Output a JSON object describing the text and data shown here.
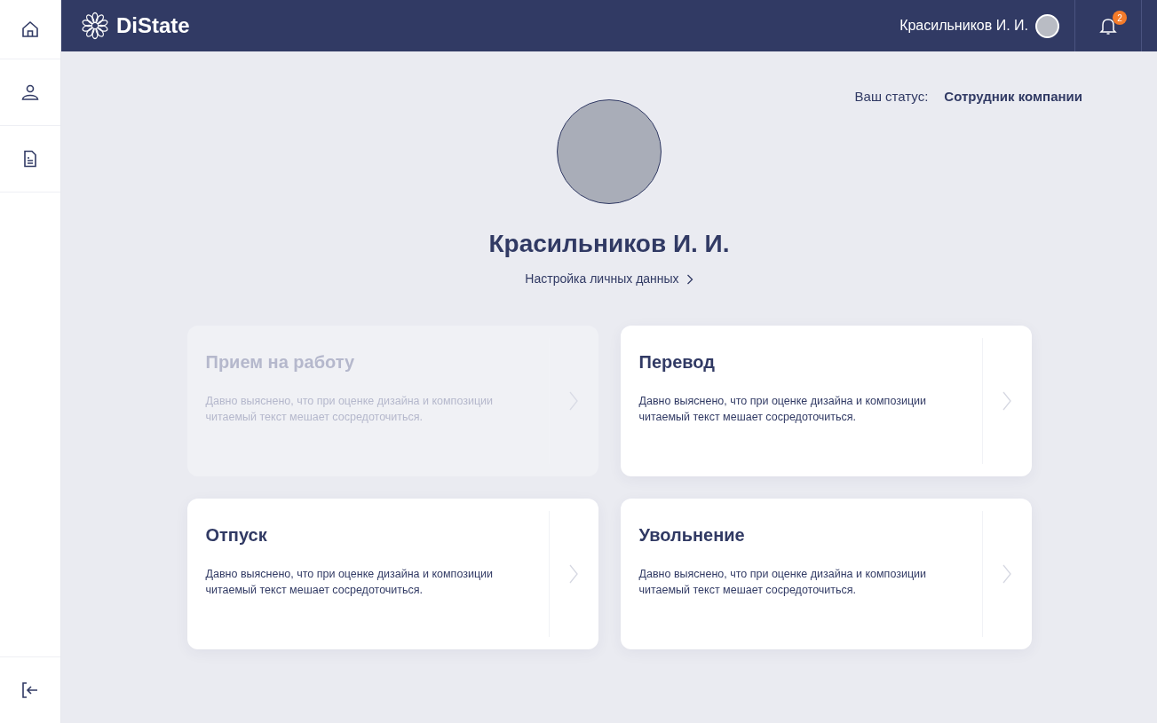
{
  "header": {
    "logo": "DiState",
    "user_name": "Красильников И. И.",
    "notifications_count": "2"
  },
  "status": {
    "label": "Ваш статус:",
    "value": "Сотрудник компании"
  },
  "profile": {
    "name": "Красильников И. И.",
    "settings_link": "Настройка личных данных"
  },
  "cards": [
    {
      "title": "Прием на работу",
      "description": "Давно выяснено, что при оценке дизайна и композиции читаемый текст мешает сосредоточиться.",
      "disabled": true
    },
    {
      "title": "Перевод",
      "description": "Давно выяснено, что при оценке дизайна и композиции читаемый текст мешает сосредоточиться.",
      "disabled": false
    },
    {
      "title": "Отпуск",
      "description": "Давно выяснено, что при оценке дизайна и композиции читаемый текст мешает сосредоточиться.",
      "disabled": false
    },
    {
      "title": "Увольнение",
      "description": "Давно выяснено, что при оценке дизайна и композиции читаемый текст мешает сосредоточиться.",
      "disabled": false
    }
  ]
}
